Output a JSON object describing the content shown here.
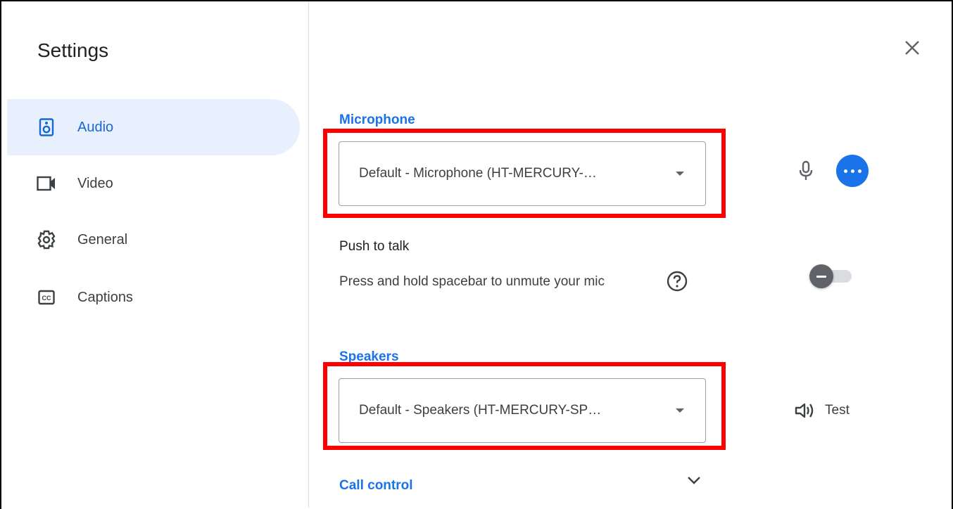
{
  "dialog": {
    "title": "Settings",
    "close_icon": "close-icon"
  },
  "sidebar": {
    "items": [
      {
        "label": "Audio",
        "icon": "speaker-box-icon",
        "active": true
      },
      {
        "label": "Video",
        "icon": "video-camera-icon",
        "active": false
      },
      {
        "label": "General",
        "icon": "gear-icon",
        "active": false
      },
      {
        "label": "Captions",
        "icon": "closed-captions-icon",
        "active": false
      }
    ]
  },
  "audio": {
    "microphone": {
      "title": "Microphone",
      "selected": "Default - Microphone (HT-MERCURY-…"
    },
    "push_to_talk": {
      "title": "Push to talk",
      "description": "Press and hold spacebar to unmute your mic",
      "enabled": false
    },
    "speakers": {
      "title": "Speakers",
      "selected": "Default - Speakers (HT-MERCURY-SP…",
      "test_label": "Test"
    },
    "call_control": {
      "title": "Call control"
    }
  },
  "colors": {
    "accent": "#1a73e8",
    "active_nav_bg": "#e8f0fe",
    "highlight": "#ff0000"
  }
}
